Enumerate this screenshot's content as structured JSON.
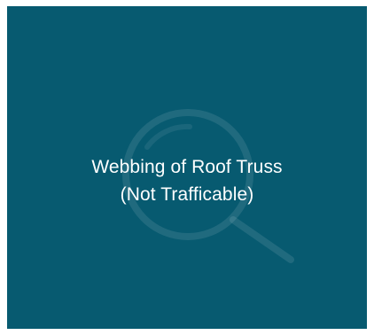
{
  "tile": {
    "caption_line_1": "Webbing of Roof Truss",
    "caption_line_2": "(Not Trafficable)",
    "icon": "magnifier-icon",
    "background_color": "#075a70",
    "text_color": "#ffffff"
  }
}
